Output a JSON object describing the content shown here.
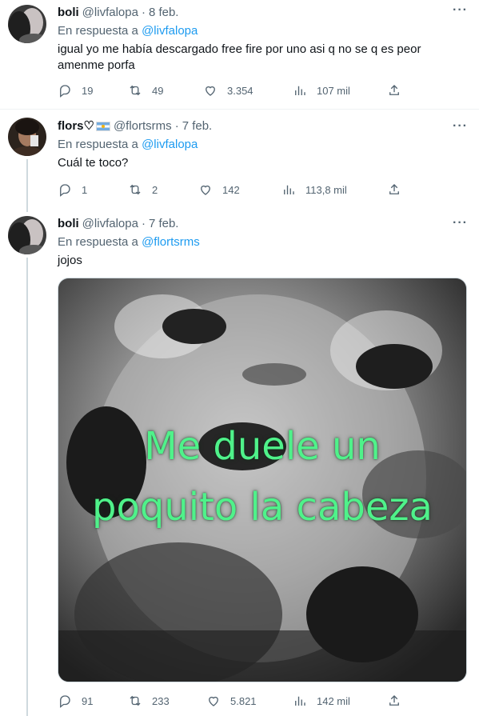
{
  "tweets": [
    {
      "name": "boli",
      "handle": "@livfalopa",
      "date": "8 feb.",
      "reply_prefix": "En respuesta a",
      "reply_to": "@livfalopa",
      "text": "igual yo me había descargado free fire por uno asi q no se q es peor amenme porfa",
      "replies": "19",
      "retweets": "49",
      "likes": "3.354",
      "views": "107 mil"
    },
    {
      "name": "flors♡",
      "flag": "argentina-flag-icon",
      "handle": "@flortsrms",
      "date": "7 feb.",
      "reply_prefix": "En respuesta a",
      "reply_to": "@livfalopa",
      "text": "Cuál te toco?",
      "replies": "1",
      "retweets": "2",
      "likes": "142",
      "views": "113,8 mil"
    },
    {
      "name": "boli",
      "handle": "@livfalopa",
      "date": "7 feb.",
      "reply_prefix": "En respuesta a",
      "reply_to": "@flortsrms",
      "text": "jojos",
      "media_caption_line1": "Me duele un",
      "media_caption_line2": "poquito la cabeza",
      "replies": "91",
      "retweets": "233",
      "likes": "5.821",
      "views": "142 mil"
    }
  ],
  "more_glyph": "···",
  "colors": {
    "link": "#1d9bf0",
    "muted": "#536471",
    "caption": "#4ff28a"
  }
}
